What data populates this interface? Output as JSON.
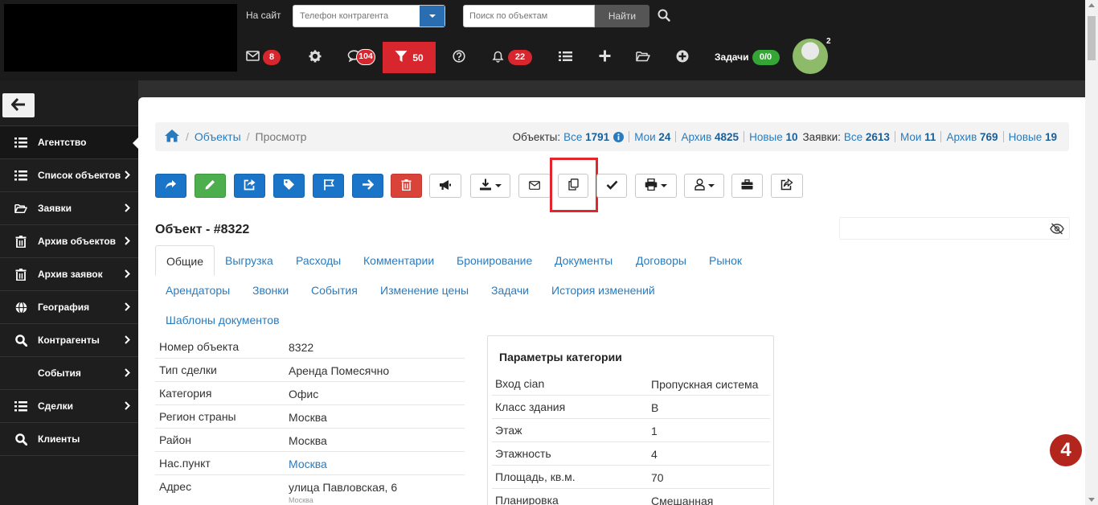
{
  "header": {
    "site_label": "На сайт",
    "phone_placeholder": "Телефон контрагента",
    "search_placeholder": "Поиск по объектам",
    "find_button": "Найти",
    "mail_count": "8",
    "messages_count": "104",
    "filter_count": "50",
    "notifications_count": "22",
    "tasks_label": "Задачи",
    "tasks_count": "0/0",
    "avatar_badge": "2"
  },
  "sidebar": {
    "items": [
      {
        "label": "Агентство",
        "icon": "list-icon"
      },
      {
        "label": "Список объектов",
        "icon": "list-icon"
      },
      {
        "label": "Заявки",
        "icon": "folder-open-icon"
      },
      {
        "label": "Архив объектов",
        "icon": "trash-icon"
      },
      {
        "label": "Архив заявок",
        "icon": "trash-icon"
      },
      {
        "label": "География",
        "icon": "globe-icon"
      },
      {
        "label": "Контрагенты",
        "icon": "search-icon"
      },
      {
        "label": "События",
        "icon": ""
      },
      {
        "label": "Сделки",
        "icon": "list-icon"
      },
      {
        "label": "Клиенты",
        "icon": "search-icon"
      }
    ]
  },
  "breadcrumb": {
    "objects": "Объекты",
    "view": "Просмотр"
  },
  "stats": {
    "objects_label": "Объекты:",
    "requests_label": "Заявки:",
    "objects": [
      {
        "label": "Все",
        "count": "1791"
      },
      {
        "label": "Мои",
        "count": "24"
      },
      {
        "label": "Архив",
        "count": "4825"
      },
      {
        "label": "Новые",
        "count": "10"
      }
    ],
    "requests": [
      {
        "label": "Все",
        "count": "2613"
      },
      {
        "label": "Мои",
        "count": "11"
      },
      {
        "label": "Архив",
        "count": "769"
      },
      {
        "label": "Новые",
        "count": "19"
      }
    ]
  },
  "object": {
    "title": "Объект - #8322"
  },
  "tabs": [
    "Общие",
    "Выгрузка",
    "Расходы",
    "Комментарии",
    "Бронирование",
    "Документы",
    "Договоры",
    "Рынок",
    "Арендаторы",
    "Звонки",
    "События",
    "Изменение цены",
    "Задачи",
    "История изменений",
    "Шаблоны документов"
  ],
  "details": [
    {
      "key": "Номер объекта",
      "value": "8322"
    },
    {
      "key": "Тип сделки",
      "value": "Аренда Помесячно"
    },
    {
      "key": "Категория",
      "value": "Офис"
    },
    {
      "key": "Регион страны",
      "value": "Москва"
    },
    {
      "key": "Район",
      "value": "Москва"
    },
    {
      "key": "Нас.пункт",
      "value": "Москва"
    },
    {
      "key": "Адрес",
      "value": "улица Павловская, 6",
      "sub": "Москва"
    }
  ],
  "params": {
    "title": "Параметры категории",
    "rows": [
      {
        "key": "Вход cian",
        "value": "Пропускная система"
      },
      {
        "key": "Класс здания",
        "value": "B"
      },
      {
        "key": "Этаж",
        "value": "1"
      },
      {
        "key": "Этажность",
        "value": "4"
      },
      {
        "key": "Площадь, кв.м.",
        "value": "70"
      },
      {
        "key": "Планировка",
        "value": "Смешанная"
      }
    ]
  },
  "step_badge": "4",
  "colors": {
    "primary_blue": "#1a75c9",
    "success_green": "#4cae4c",
    "danger_red": "#d9433a",
    "highlight_red": "#e3262c",
    "topbar": "#1b1b1b",
    "sidebar": "#1e1e1e"
  }
}
